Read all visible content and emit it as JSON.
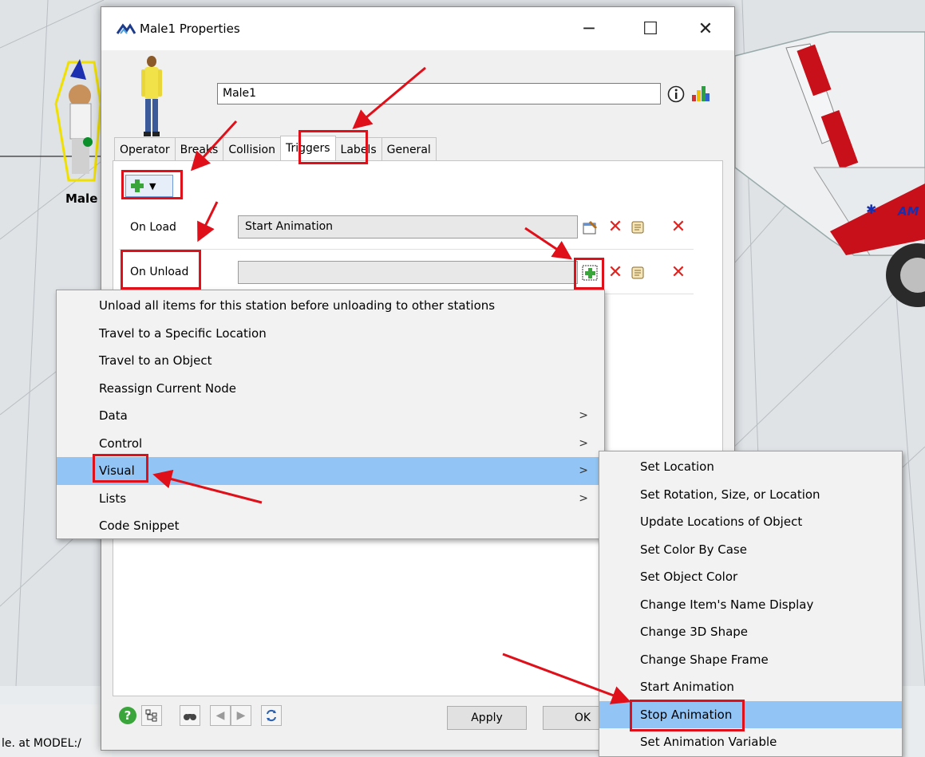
{
  "background": {
    "status_text": "le. at MODEL:/",
    "object_caption": "Male",
    "ambulance_text": "AM"
  },
  "dialog": {
    "title": "Male1  Properties",
    "name_value": "Male1",
    "tabs": [
      "Operator",
      "Breaks",
      "Collision",
      "Triggers",
      "Labels",
      "General"
    ],
    "active_tab": "Triggers",
    "triggers": [
      {
        "label": "On Load",
        "value": "Start Animation"
      },
      {
        "label": "On Unload",
        "value": ""
      }
    ],
    "apply_label": "Apply",
    "ok_label": "OK"
  },
  "context_menu": {
    "items": [
      {
        "label": "Unload all items for this station before unloading to other stations",
        "submenu": false
      },
      {
        "label": "Travel to a Specific Location",
        "submenu": false
      },
      {
        "label": "Travel to an Object",
        "submenu": false
      },
      {
        "label": "Reassign Current Node",
        "submenu": false
      },
      {
        "label": "Data",
        "submenu": true
      },
      {
        "label": "Control",
        "submenu": true
      },
      {
        "label": "Visual",
        "submenu": true,
        "highlighted": true
      },
      {
        "label": "Lists",
        "submenu": true
      },
      {
        "label": "Code Snippet",
        "submenu": false
      }
    ]
  },
  "visual_submenu": {
    "items": [
      {
        "label": "Set Location"
      },
      {
        "label": "Set Rotation, Size, or Location"
      },
      {
        "label": "Update Locations of Object"
      },
      {
        "label": "Set Color By Case"
      },
      {
        "label": "Set Object Color"
      },
      {
        "label": "Change Item's Name Display"
      },
      {
        "label": "Change 3D Shape"
      },
      {
        "label": "Change Shape Frame"
      },
      {
        "label": "Start Animation"
      },
      {
        "label": "Stop Animation",
        "highlighted": true
      },
      {
        "label": "Set Animation Variable"
      }
    ]
  },
  "icons": {
    "title": "flexsim-logo-icon",
    "info": "info-icon",
    "chart": "chart-icon",
    "add": "green-plus-icon",
    "delete": "red-x-icon"
  },
  "colors": {
    "highlight": "#92c5f5",
    "annotation": "#e0101a",
    "plus": "#3aa53a"
  }
}
